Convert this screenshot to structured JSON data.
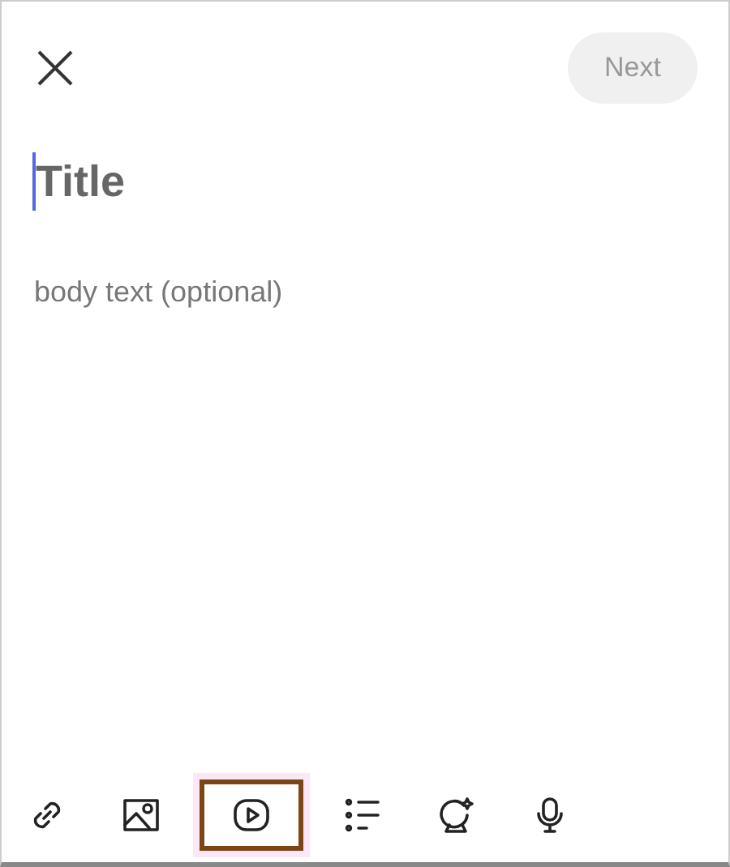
{
  "header": {
    "next_button": {
      "label": "Next",
      "disabled": true
    }
  },
  "title_field": {
    "placeholder": "Title",
    "focused": true
  },
  "body_field": {
    "placeholder": "body text (optional)"
  },
  "toolbar": [
    {
      "kind": "link",
      "highlighted": false
    },
    {
      "kind": "image",
      "highlighted": false
    },
    {
      "kind": "video",
      "highlighted": true
    },
    {
      "kind": "poll",
      "highlighted": false
    },
    {
      "kind": "ama",
      "highlighted": false
    },
    {
      "kind": "mic",
      "highlighted": false
    }
  ]
}
